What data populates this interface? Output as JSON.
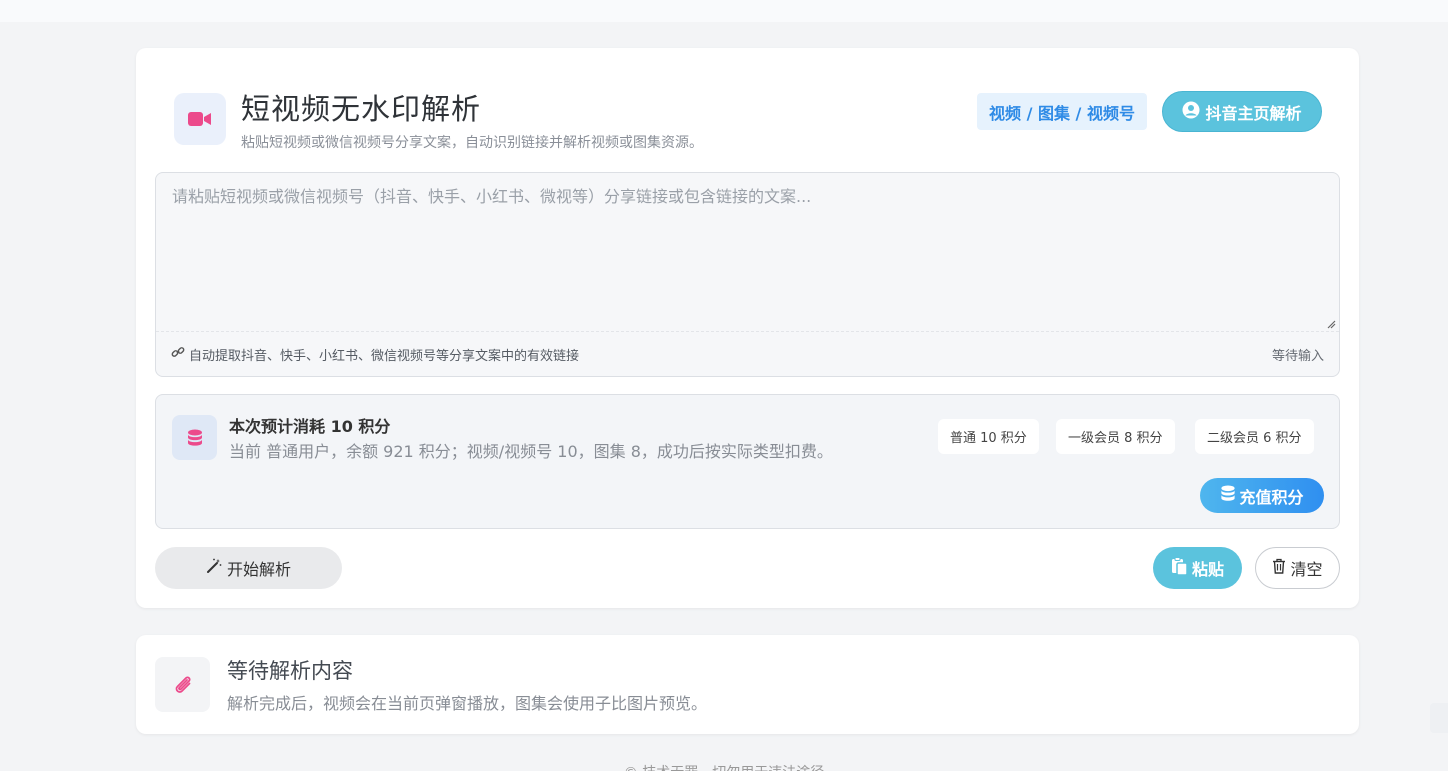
{
  "header": {
    "title": "短视频无水印解析",
    "subtitle": "粘贴短视频或微信视频号分享文案，自动识别链接并解析视频或图集资源。",
    "types_badge": "视频 / 图集 / 视频号",
    "profile_button": "抖音主页解析",
    "icon": "video-camera-icon"
  },
  "input": {
    "placeholder": "请粘贴短视频或微信视频号（抖音、快手、小红书、微视等）分享链接或包含链接的文案...",
    "value": "",
    "hint": "自动提取抖音、快手、小红书、微信视频号等分享文案中的有效链接",
    "status": "等待输入"
  },
  "cost": {
    "title": "本次预计消耗 10 积分",
    "description": "当前 普通用户，余额 921 积分；视频/视频号 10，图集 8，成功后按实际类型扣费。",
    "tiers": [
      "普通 10 积分",
      "一级会员 8 积分",
      "二级会员 6 积分"
    ],
    "recharge_button": "充值积分"
  },
  "actions": {
    "start": "开始解析",
    "paste": "粘贴",
    "clear": "清空"
  },
  "result": {
    "title": "等待解析内容",
    "description": "解析完成后，视频会在当前页弹窗播放，图集会使用子比图片预览。"
  },
  "footer": "© 技术无罪，切勿用于违法途径",
  "colors": {
    "accent_pink": "#ec4a8b",
    "accent_blue": "#2f8be6",
    "button_cyan": "#5bc3dd"
  }
}
